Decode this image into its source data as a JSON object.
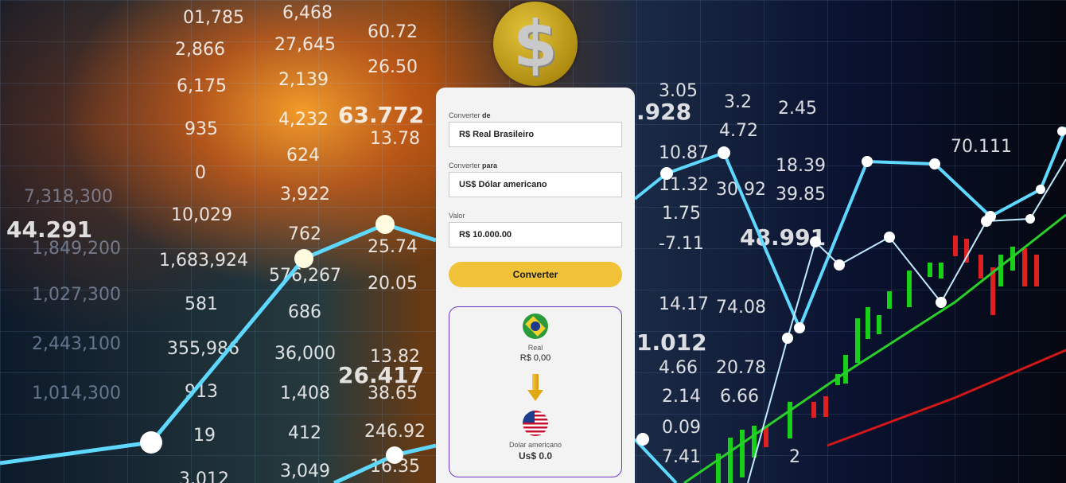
{
  "form": {
    "from_label_prefix": "Converter ",
    "from_label_bold": "de",
    "from_value": "R$ Real Brasileiro",
    "to_label_prefix": "Converter ",
    "to_label_bold": "para",
    "to_value": "US$ Dólar americano",
    "amount_label": "Valor",
    "amount_value": "R$ 10.000.00",
    "submit_label": "Converter"
  },
  "result": {
    "from_name": "Real",
    "from_value": "R$ 0,00",
    "to_name": "Dolar americano",
    "to_value": "Us$ 0.0"
  },
  "icons": {
    "logo": "dollar-coin-icon",
    "from_flag": "brazil-flag-icon",
    "to_flag": "usa-flag-icon",
    "arrow": "arrow-down-icon"
  },
  "colors": {
    "accent_button": "#f0c238",
    "result_border": "#6b35c4",
    "card_bg": "#f4f3f3"
  }
}
